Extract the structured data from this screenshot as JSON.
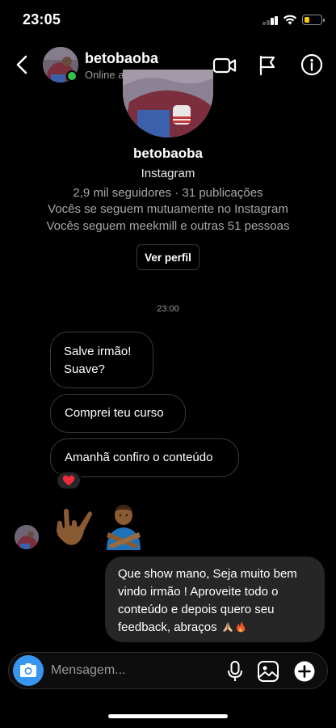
{
  "status_bar": {
    "time": "23:05",
    "icons": [
      "signal-icon",
      "wifi-icon",
      "battery-icon"
    ],
    "battery_color": "#f5c518"
  },
  "header": {
    "username": "betobaoba",
    "status": "Online agora",
    "online_color": "#37c24a",
    "icons": [
      "back-arrow-icon",
      "video-call-icon",
      "flag-icon",
      "info-icon"
    ]
  },
  "profile": {
    "name": "betobaoba",
    "platform": "Instagram",
    "stats": "2,9 mil seguidores · 31 publicações",
    "mutual": "Vocês se seguem mutuamente no Instagram",
    "following": "Vocês seguem meekmill e outras 51 pessoas",
    "view_profile_label": "Ver perfil"
  },
  "conversation": {
    "timestamp": "23:00",
    "incoming": [
      {
        "line1": "Salve irmão!",
        "line2": "Suave?"
      },
      {
        "text": "Comprei teu curso"
      },
      {
        "text": "Amanhã confiro o conteúdo",
        "reaction": "heart-icon"
      }
    ],
    "incoming_emoji": [
      "love-you-gesture-icon",
      "person-gesturing-no-icon"
    ],
    "outgoing": {
      "line1": "Que show mano, Seja muito bem",
      "line2": "vindo irmão ! Aproveite todo o",
      "line3": "conteúdo e depois quero seu",
      "line4": "feedback, abraços",
      "emoji": [
        "folded-hands-icon",
        "fire-icon"
      ]
    }
  },
  "composer": {
    "placeholder": "Mensagem...",
    "accent": "#3797f0",
    "icons": [
      "camera-icon",
      "microphone-icon",
      "gallery-icon",
      "plus-circle-icon"
    ]
  }
}
